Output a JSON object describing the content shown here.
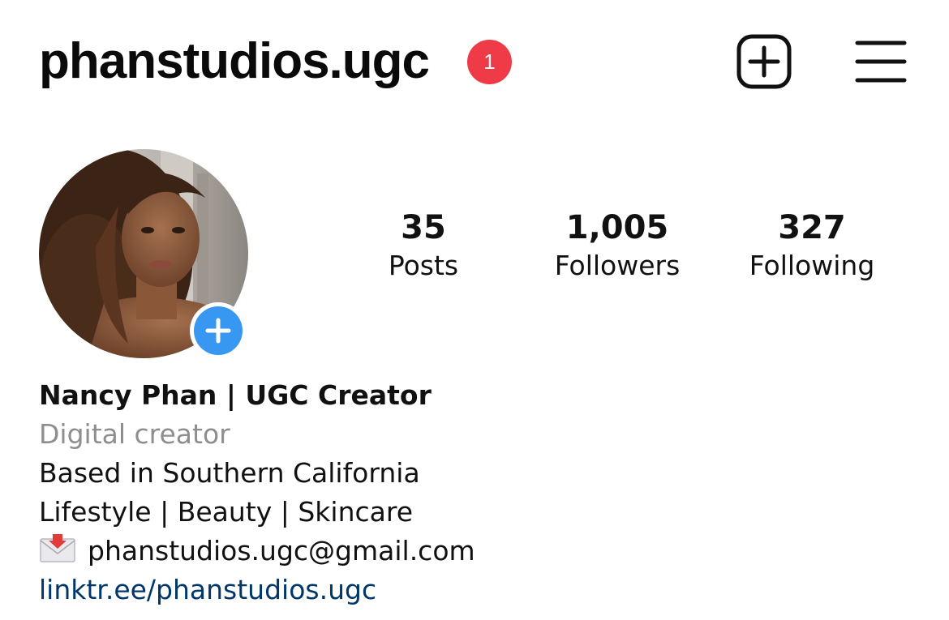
{
  "header": {
    "username": "phanstudios.ugc",
    "notification_count": "1",
    "create_icon": "plus-square-icon",
    "menu_icon": "hamburger-menu-icon"
  },
  "profile": {
    "avatar": "profile-photo",
    "add_story_icon": "plus-icon",
    "stats": [
      {
        "value": "35",
        "label": "Posts"
      },
      {
        "value": "1,005",
        "label": "Followers"
      },
      {
        "value": "327",
        "label": "Following"
      }
    ]
  },
  "bio": {
    "name": "Nancy Phan | UGC Creator",
    "category": "Digital creator",
    "lines": [
      "Based in Southern California",
      "Lifestyle | Beauty | Skincare"
    ],
    "email_icon": "envelope-icon",
    "email": "phanstudios.ugc@gmail.com",
    "link": "linktr.ee/phanstudios.ugc"
  },
  "colors": {
    "badge": "#ef3a47",
    "add_story": "#3897f0",
    "link": "#00376b",
    "category": "#8e8e8e"
  }
}
